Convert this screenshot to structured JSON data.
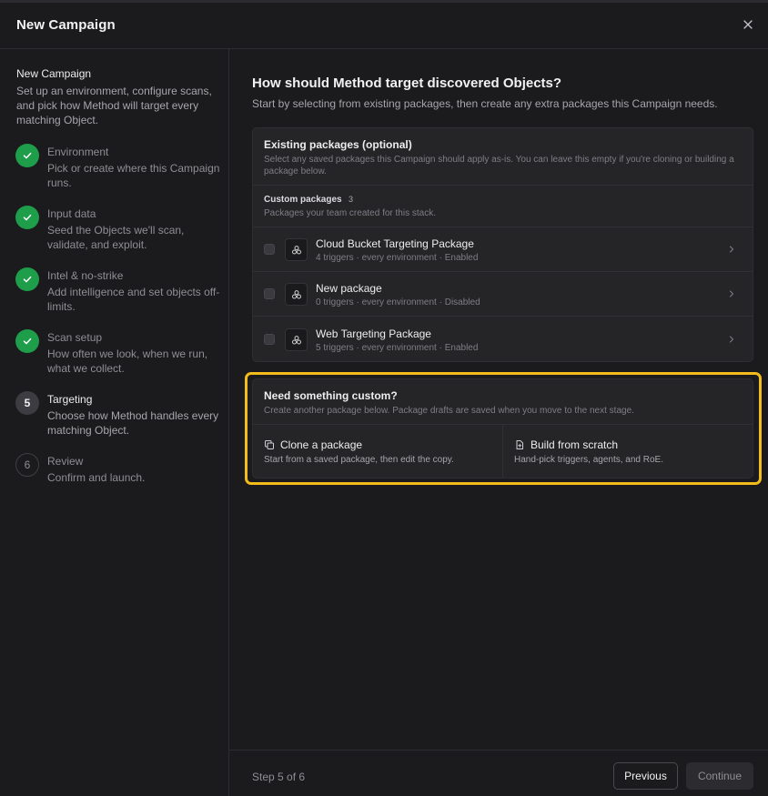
{
  "header": {
    "title": "New Campaign"
  },
  "sidebar": {
    "title": "New Campaign",
    "description": "Set up an environment, configure scans, and pick how Method will target every matching Object.",
    "steps": [
      {
        "number": "1",
        "label": "Environment",
        "description": "Pick or create where this Campaign runs.",
        "status": "done"
      },
      {
        "number": "2",
        "label": "Input data",
        "description": "Seed the Objects we'll scan, validate, and exploit.",
        "status": "done"
      },
      {
        "number": "3",
        "label": "Intel & no-strike",
        "description": "Add intelligence and set objects off-limits.",
        "status": "done"
      },
      {
        "number": "4",
        "label": "Scan setup",
        "description": "How often we look, when we run, what we collect.",
        "status": "done"
      },
      {
        "number": "5",
        "label": "Targeting",
        "description": "Choose how Method handles every matching Object.",
        "status": "current"
      },
      {
        "number": "6",
        "label": "Review",
        "description": "Confirm and launch.",
        "status": "future"
      }
    ]
  },
  "main": {
    "title": "How should Method target discovered Objects?",
    "subtitle": "Start by selecting from existing packages, then create any extra packages this Campaign needs.",
    "existing": {
      "title": "Existing packages (optional)",
      "description": "Select any saved packages this Campaign should apply as-is. You can leave this empty if you're cloning or building a package below.",
      "group": {
        "title": "Custom packages",
        "count": "3",
        "description": "Packages your team created for this stack."
      },
      "packages": [
        {
          "name": "Cloud Bucket Targeting Package",
          "meta": "4 triggers · every environment · Enabled"
        },
        {
          "name": "New package",
          "meta": "0 triggers · every environment · Disabled"
        },
        {
          "name": "Web Targeting Package",
          "meta": "5 triggers · every environment · Enabled"
        }
      ]
    },
    "custom": {
      "title": "Need something custom?",
      "description": "Create another package below. Package drafts are saved when you move to the next stage.",
      "clone": {
        "label": "Clone a package",
        "description": "Start from a saved package, then edit the copy."
      },
      "scratch": {
        "label": "Build from scratch",
        "description": "Hand-pick triggers, agents, and RoE."
      }
    }
  },
  "footer": {
    "step_text": "Step 5 of 6",
    "previous_label": "Previous",
    "continue_label": "Continue"
  },
  "colors": {
    "background": "#1b1b1d",
    "card": "#252528",
    "success": "#1e9e4a",
    "highlight": "#f3bb1c"
  }
}
